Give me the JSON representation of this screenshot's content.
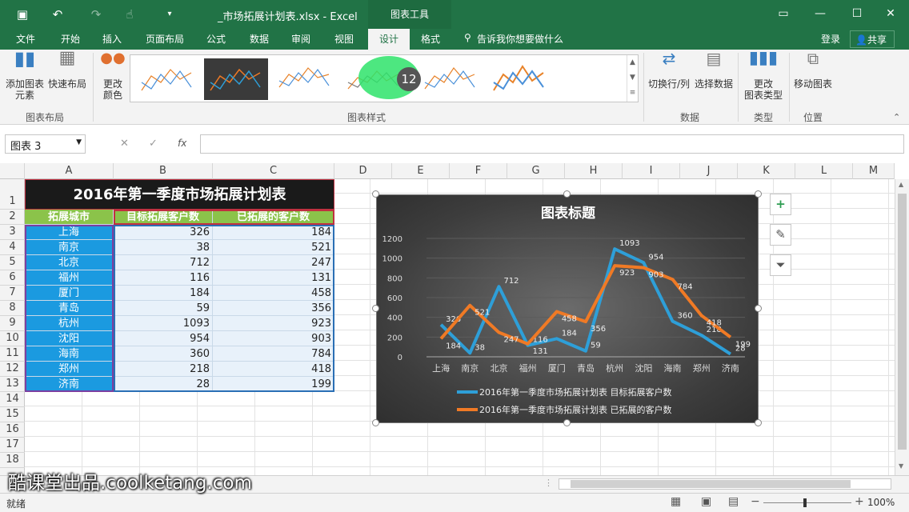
{
  "titlebar": {
    "filename": "_市场拓展计划表.xlsx - Excel",
    "context_tab": "图表工具"
  },
  "tabs": [
    "文件",
    "开始",
    "插入",
    "页面布局",
    "公式",
    "数据",
    "审阅",
    "视图",
    "设计",
    "格式"
  ],
  "tellme": "告诉我你想要做什么",
  "login": "登录",
  "share": "共享",
  "ribbon": {
    "add_element": "添加图表",
    "add_element2": "元素",
    "quick_layout": "快速布局",
    "change_color": "更改",
    "change_color2": "颜色",
    "group_layout": "图表布局",
    "group_styles": "图表样式",
    "switch": "切换行/列",
    "select_data": "选择数据",
    "group_data": "数据",
    "change_type": "更改",
    "change_type2": "图表类型",
    "group_type": "类型",
    "move_chart": "移动图表",
    "group_location": "位置"
  },
  "step_badge": "12",
  "namebox": "图表 3",
  "fx": "fx",
  "columns": [
    "A",
    "B",
    "C",
    "D",
    "E",
    "F",
    "G",
    "H",
    "I",
    "J",
    "K",
    "L",
    "M"
  ],
  "rows": [
    "1",
    "2",
    "3",
    "4",
    "5",
    "6",
    "7",
    "8",
    "9",
    "10",
    "11",
    "12",
    "13",
    "14",
    "15",
    "16",
    "17",
    "18"
  ],
  "table": {
    "title": "2016年第一季度市场拓展计划表",
    "headers": [
      "拓展城市",
      "目标拓展客户数",
      "已拓展的客户数"
    ],
    "rows": [
      [
        "上海",
        "326",
        "184"
      ],
      [
        "南京",
        "38",
        "521"
      ],
      [
        "北京",
        "712",
        "247"
      ],
      [
        "福州",
        "116",
        "131"
      ],
      [
        "厦门",
        "184",
        "458"
      ],
      [
        "青岛",
        "59",
        "356"
      ],
      [
        "杭州",
        "1093",
        "923"
      ],
      [
        "沈阳",
        "954",
        "903"
      ],
      [
        "海南",
        "360",
        "784"
      ],
      [
        "郑州",
        "218",
        "418"
      ],
      [
        "济南",
        "28",
        "199"
      ]
    ]
  },
  "chart_data": {
    "type": "line",
    "title": "图表标题",
    "categories": [
      "上海",
      "南京",
      "北京",
      "福州",
      "厦门",
      "青岛",
      "杭州",
      "沈阳",
      "海南",
      "郑州",
      "济南"
    ],
    "series": [
      {
        "name": "2016年第一季度市场拓展计划表 目标拓展客户数",
        "values": [
          326,
          38,
          712,
          116,
          184,
          59,
          1093,
          954,
          360,
          218,
          28
        ],
        "color": "#2e9fd8"
      },
      {
        "name": "2016年第一季度市场拓展计划表 已拓展的客户数",
        "values": [
          184,
          521,
          247,
          131,
          458,
          356,
          923,
          903,
          784,
          418,
          199
        ],
        "color": "#f07a25"
      }
    ],
    "yticks": [
      "0",
      "200",
      "400",
      "600",
      "800",
      "1000",
      "1200"
    ],
    "ylim": [
      0,
      1200
    ],
    "grid": true,
    "legend": "bottom"
  },
  "watermark": "酷课堂出品.coolketang.com",
  "status": {
    "ready": "就绪",
    "zoom": "100%"
  },
  "colors": {
    "excel_green": "#217346",
    "header_fill": "#8bc34a",
    "city_fill": "#1b9ae0",
    "data_fill": "#e8f1fa",
    "title_fill": "#1a1a1a"
  }
}
